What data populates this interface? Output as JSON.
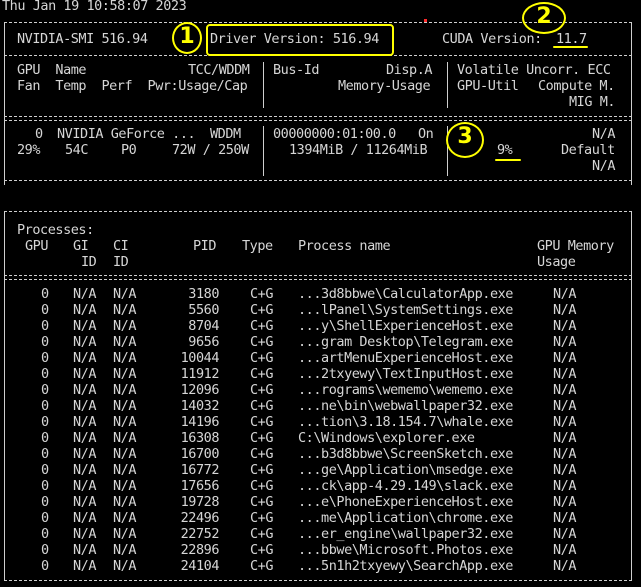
{
  "timestamp": "Thu Jan 19 10:58:07 2023",
  "smi": {
    "name": "NVIDIA-SMI 516.94",
    "driver": "Driver Version: 516.94",
    "cuda_label": "CUDA Version: ",
    "cuda_value": "11.7"
  },
  "gpu_header": {
    "r1_c1": "GPU  Name",
    "r1_c2": "TCC/WDDM",
    "r1_c3": "Bus-Id",
    "r1_c4": "Disp.A",
    "r1_c5": "Volatile Uncorr. ECC",
    "r2_c1": "Fan  Temp  Perf  Pwr:Usage/Cap",
    "r2_c3": "Memory-Usage",
    "r2_c5a": "GPU-Util",
    "r2_c5b": "Compute M.",
    "r3_c5": "MIG M."
  },
  "gpu": {
    "index": "0",
    "name": "NVIDIA GeForce ...",
    "mode": "WDDM",
    "bus_id": "00000000:01:00.0",
    "disp": "On",
    "ecc": "N/A",
    "fan": "29%",
    "temp": "54C",
    "perf": "P0",
    "power": "72W / 250W",
    "memory": "1394MiB / 11264MiB",
    "util": "9%",
    "compute": "Default",
    "mig": "N/A"
  },
  "proc_header": {
    "title": "Processes:",
    "gpu": "GPU",
    "gi": "GI",
    "ci": "CI",
    "id": "ID",
    "pid": "PID",
    "type": "Type",
    "pname": "Process name",
    "mem1": "GPU Memory",
    "mem2": "Usage"
  },
  "processes": [
    {
      "gpu": "0",
      "gi": "N/A",
      "ci": "N/A",
      "pid": "3180",
      "type": "C+G",
      "name": "...3d8bbwe\\CalculatorApp.exe",
      "mem": "N/A"
    },
    {
      "gpu": "0",
      "gi": "N/A",
      "ci": "N/A",
      "pid": "5560",
      "type": "C+G",
      "name": "...lPanel\\SystemSettings.exe",
      "mem": "N/A"
    },
    {
      "gpu": "0",
      "gi": "N/A",
      "ci": "N/A",
      "pid": "8704",
      "type": "C+G",
      "name": "...y\\ShellExperienceHost.exe",
      "mem": "N/A"
    },
    {
      "gpu": "0",
      "gi": "N/A",
      "ci": "N/A",
      "pid": "9656",
      "type": "C+G",
      "name": "...gram Desktop\\Telegram.exe",
      "mem": "N/A"
    },
    {
      "gpu": "0",
      "gi": "N/A",
      "ci": "N/A",
      "pid": "10044",
      "type": "C+G",
      "name": "...artMenuExperienceHost.exe",
      "mem": "N/A"
    },
    {
      "gpu": "0",
      "gi": "N/A",
      "ci": "N/A",
      "pid": "11912",
      "type": "C+G",
      "name": "...2txyewy\\TextInputHost.exe",
      "mem": "N/A"
    },
    {
      "gpu": "0",
      "gi": "N/A",
      "ci": "N/A",
      "pid": "12096",
      "type": "C+G",
      "name": "...rograms\\wememo\\wememo.exe",
      "mem": "N/A"
    },
    {
      "gpu": "0",
      "gi": "N/A",
      "ci": "N/A",
      "pid": "14032",
      "type": "C+G",
      "name": "...ne\\bin\\webwallpaper32.exe",
      "mem": "N/A"
    },
    {
      "gpu": "0",
      "gi": "N/A",
      "ci": "N/A",
      "pid": "14196",
      "type": "C+G",
      "name": "...tion\\3.18.154.7\\whale.exe",
      "mem": "N/A"
    },
    {
      "gpu": "0",
      "gi": "N/A",
      "ci": "N/A",
      "pid": "16308",
      "type": "C+G",
      "name": "C:\\Windows\\explorer.exe",
      "mem": "N/A"
    },
    {
      "gpu": "0",
      "gi": "N/A",
      "ci": "N/A",
      "pid": "16700",
      "type": "C+G",
      "name": "...b3d8bbwe\\ScreenSketch.exe",
      "mem": "N/A"
    },
    {
      "gpu": "0",
      "gi": "N/A",
      "ci": "N/A",
      "pid": "16772",
      "type": "C+G",
      "name": "...ge\\Application\\msedge.exe",
      "mem": "N/A"
    },
    {
      "gpu": "0",
      "gi": "N/A",
      "ci": "N/A",
      "pid": "17656",
      "type": "C+G",
      "name": "...ck\\app-4.29.149\\slack.exe",
      "mem": "N/A"
    },
    {
      "gpu": "0",
      "gi": "N/A",
      "ci": "N/A",
      "pid": "19728",
      "type": "C+G",
      "name": "...e\\PhoneExperienceHost.exe",
      "mem": "N/A"
    },
    {
      "gpu": "0",
      "gi": "N/A",
      "ci": "N/A",
      "pid": "22496",
      "type": "C+G",
      "name": "...me\\Application\\chrome.exe",
      "mem": "N/A"
    },
    {
      "gpu": "0",
      "gi": "N/A",
      "ci": "N/A",
      "pid": "22752",
      "type": "C+G",
      "name": "...er_engine\\wallpaper32.exe",
      "mem": "N/A"
    },
    {
      "gpu": "0",
      "gi": "N/A",
      "ci": "N/A",
      "pid": "22896",
      "type": "C+G",
      "name": "...bbwe\\Microsoft.Photos.exe",
      "mem": "N/A"
    },
    {
      "gpu": "0",
      "gi": "N/A",
      "ci": "N/A",
      "pid": "24104",
      "type": "C+G",
      "name": "...5n1h2txyewy\\SearchApp.exe",
      "mem": "N/A"
    }
  ],
  "annotations": [
    "1",
    "2",
    "3"
  ],
  "colors": {
    "background": "#000000",
    "text": "#d6d6d6",
    "highlight": "#ffff00",
    "marker": "#ff2a2a"
  }
}
